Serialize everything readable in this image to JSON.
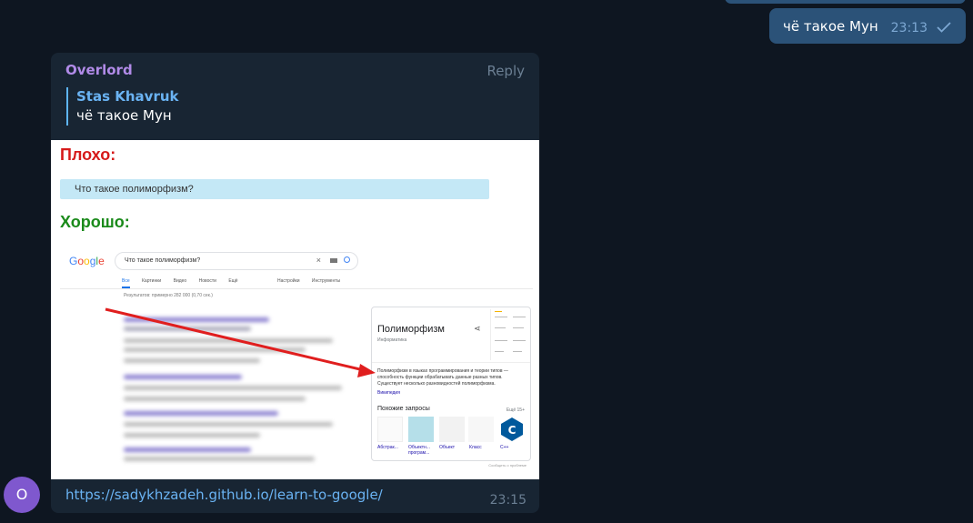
{
  "outgoing_message": {
    "text": "чё такое Мун",
    "time": "23:13",
    "status_icon": "check-icon"
  },
  "incoming_message": {
    "sender": "Overlord",
    "reply_label": "Reply",
    "quote": {
      "author": "Stas Khavruk",
      "text": "чё такое Мун"
    },
    "link": "https://sadykhzadeh.github.io/learn-to-google/",
    "time": "23:15"
  },
  "preview": {
    "bad_label": "Плохо:",
    "bad_query": "Что такое полиморфизм?",
    "good_label": "Хорошо:",
    "google": {
      "search_text": "Что такое полиморфизм?",
      "tabs": [
        "Все",
        "Картинки",
        "Видео",
        "Новости",
        "Ещё"
      ],
      "tools": [
        "Настройки",
        "Инструменты"
      ],
      "stats": "Результатов: примерно 282 000 (0,70 сек.)",
      "knowledge_panel": {
        "title": "Полиморфизм",
        "subtitle": "Информатика",
        "description": "Полиморфизм в языках программирования и теории типов — способность функции обрабатывать данные разных типов. Существует несколько разновидностей полиморфизма.",
        "source_link": "Википедия",
        "related_heading": "Похожие запросы",
        "related_more": "Ещё 15+",
        "related_items": [
          "Абстрак...",
          "Объектн... програм...",
          "Объект",
          "Класс",
          "C++"
        ]
      },
      "report": "Сообщить о проблеме"
    }
  },
  "avatar": {
    "letter": "O",
    "color": "#7f58ce"
  },
  "colors": {
    "background": "#0e1621",
    "incoming_bubble": "#182533",
    "outgoing_bubble": "#2b5278",
    "link": "#6ab3f3",
    "sender": "#b18be8",
    "bad": "#d61a1a",
    "good": "#1a8a1a"
  }
}
